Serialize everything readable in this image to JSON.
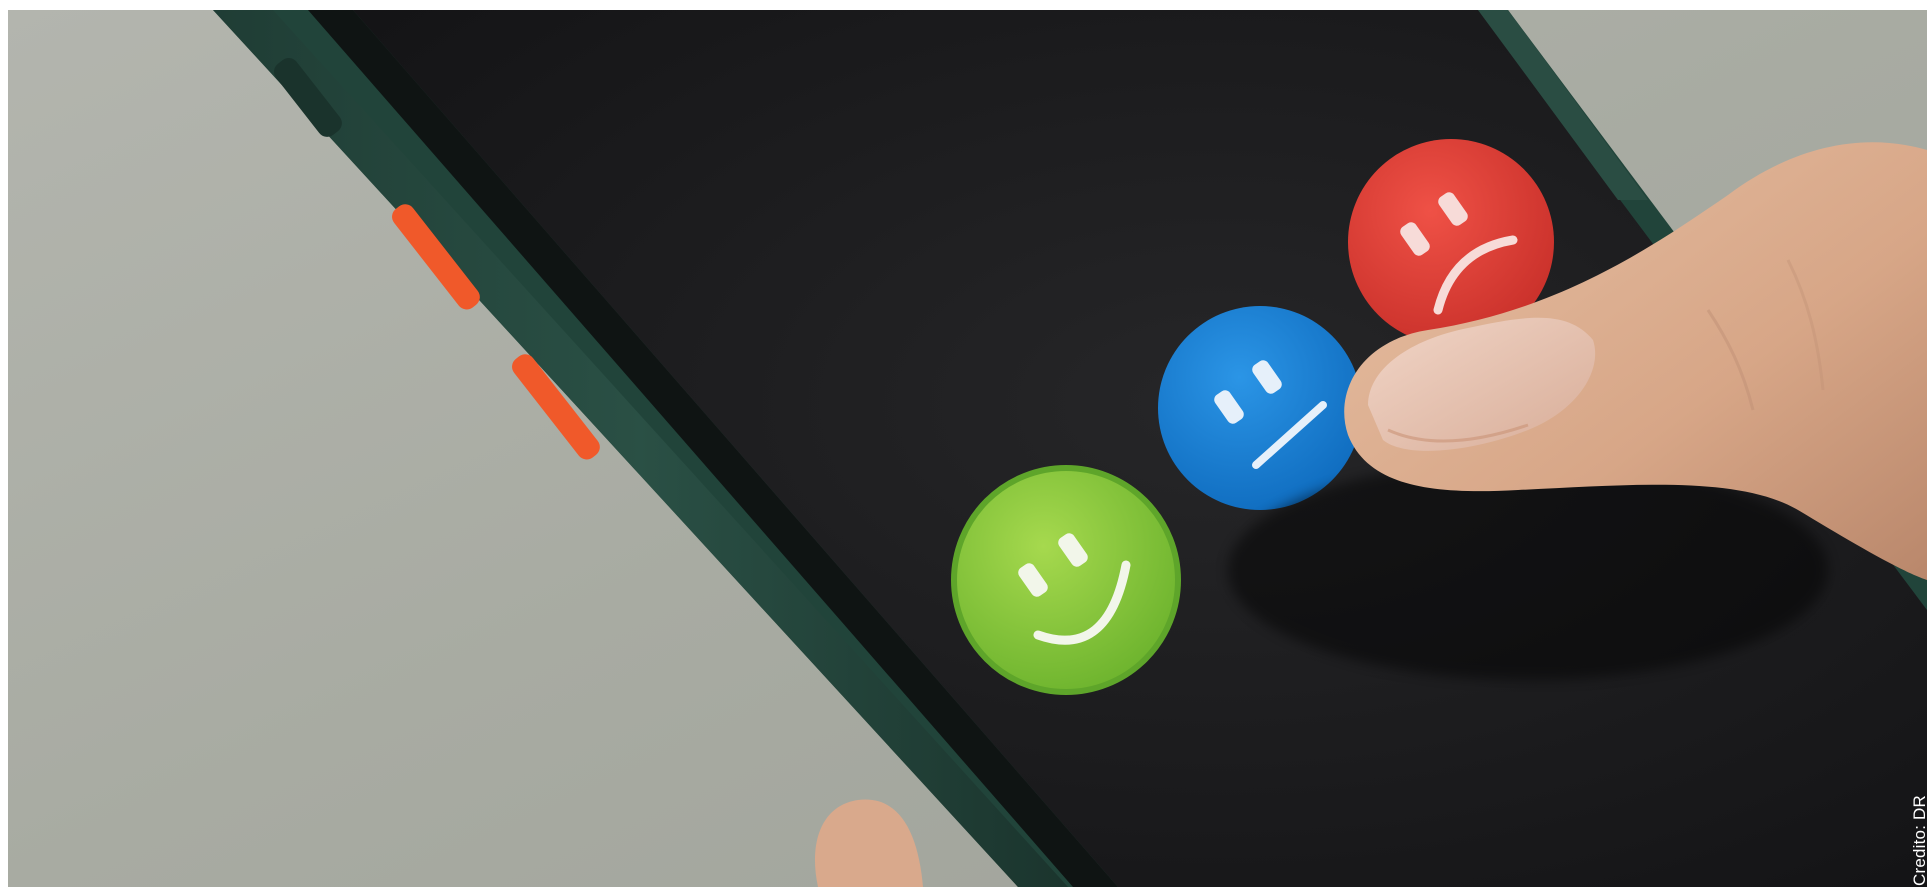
{
  "photo": {
    "subject": "smartphone-feedback-rating",
    "emojis": [
      {
        "name": "happy-face",
        "color": "#8bc53f"
      },
      {
        "name": "neutral-face",
        "color": "#1a7fd4"
      },
      {
        "name": "sad-face",
        "color": "#e8443a"
      }
    ],
    "phone_case_color": "#24473d",
    "button_color": "#f05a2a",
    "screen_color": "#1d1d1f",
    "background_color": "#a9aca3"
  },
  "credit": "Credito: DR"
}
